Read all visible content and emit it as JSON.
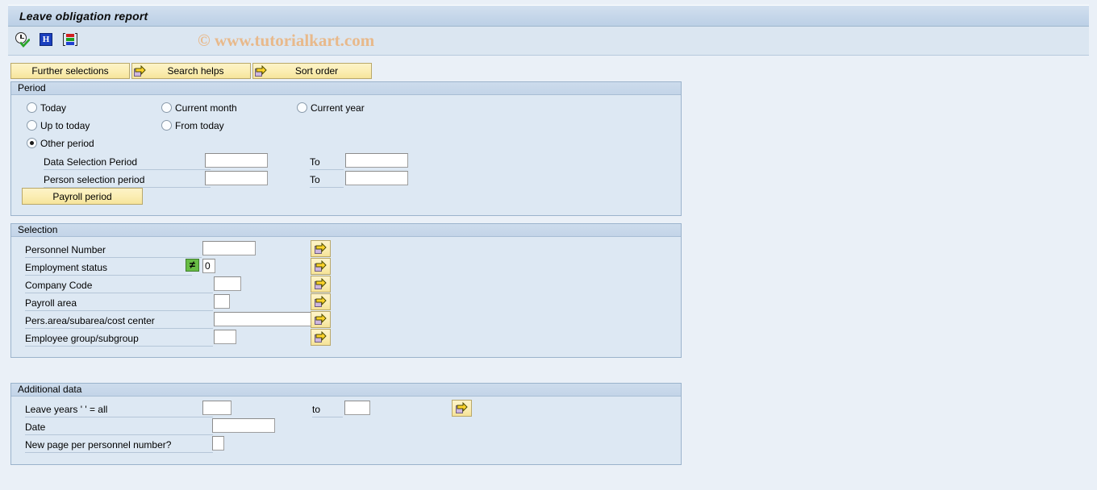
{
  "window": {
    "title": "Leave obligation report"
  },
  "toolbar": {
    "icons": [
      {
        "name": "execute-clock-icon",
        "label": "Execute"
      },
      {
        "name": "info-icon",
        "label": "Information"
      },
      {
        "name": "color-bars-icon",
        "label": "Layout"
      }
    ],
    "watermark": "© www.tutorialkart.com"
  },
  "buttons": {
    "further_selections": "Further selections",
    "search_helps": "Search helps",
    "sort_order": "Sort order"
  },
  "period": {
    "header": "Period",
    "radios": [
      {
        "label": "Today",
        "selected": false
      },
      {
        "label": "Current month",
        "selected": false
      },
      {
        "label": "Current year",
        "selected": false
      },
      {
        "label": "Up to today",
        "selected": false
      },
      {
        "label": "From today",
        "selected": false
      },
      {
        "label": "Other period",
        "selected": true
      }
    ],
    "rows": [
      {
        "label": "Data Selection Period",
        "value": "",
        "to_label": "To",
        "to_value": ""
      },
      {
        "label": "Person selection period",
        "value": "",
        "to_label": "To",
        "to_value": ""
      }
    ],
    "payroll_period_button": "Payroll period"
  },
  "selection": {
    "header": "Selection",
    "rows": [
      {
        "label": "Personnel Number",
        "value": "",
        "operator": "",
        "has_operator": false
      },
      {
        "label": "Employment status",
        "value": "0",
        "operator": "≠",
        "has_operator": true
      },
      {
        "label": "Company Code",
        "value": "",
        "operator": "",
        "has_operator": false
      },
      {
        "label": "Payroll area",
        "value": "",
        "operator": "",
        "has_operator": false
      },
      {
        "label": "Pers.area/subarea/cost center",
        "value": "",
        "operator": "",
        "has_operator": false
      },
      {
        "label": "Employee group/subgroup",
        "value": "",
        "operator": "",
        "has_operator": false
      }
    ]
  },
  "additional_data": {
    "header": "Additional data",
    "rows": [
      {
        "label": "Leave years ' ' = all",
        "value": "",
        "to_label": "to",
        "to_value": ""
      },
      {
        "label": "Date",
        "value": ""
      },
      {
        "label": "New page per personnel number?",
        "value": ""
      }
    ]
  },
  "colors": {
    "title_bar": "#c6d7ea",
    "toolbar": "#dbe6f1",
    "panel": "#dde8f3",
    "panel_header": "#c3d4e8",
    "button_yellow": "#fbeeb4",
    "operator_green": "#68bd45",
    "watermark": "#e8b98b",
    "page_bg": "#eaf0f7"
  }
}
